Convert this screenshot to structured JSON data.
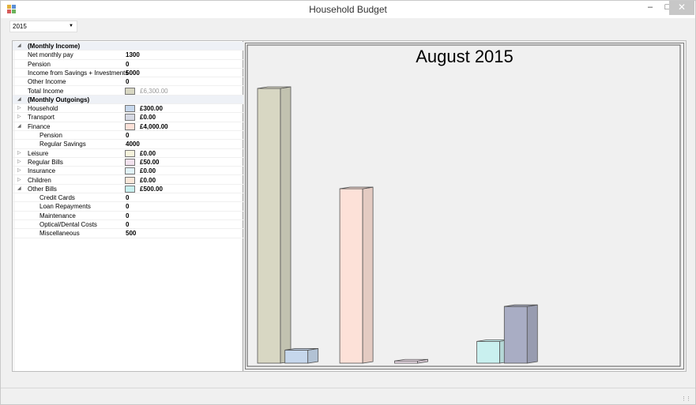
{
  "window": {
    "title": "Household Budget",
    "minimize": "–",
    "maximize": "□",
    "close": "✕"
  },
  "year_selector": {
    "value": "2015",
    "arrow": "▼"
  },
  "grid": {
    "rows": [
      {
        "kind": "cat",
        "toggle": "◢",
        "label": "(Monthly Income)",
        "value": ""
      },
      {
        "kind": "prop",
        "toggle": "",
        "label": "Net monthly pay",
        "value": "1300"
      },
      {
        "kind": "prop",
        "toggle": "",
        "label": "Pension",
        "value": "0"
      },
      {
        "kind": "prop",
        "toggle": "",
        "label": "Income from Savings + Investments",
        "value": "5000"
      },
      {
        "kind": "prop",
        "toggle": "",
        "label": "Other Income",
        "value": "0"
      },
      {
        "kind": "total",
        "toggle": "",
        "label": "Total Income",
        "value": "£6,300.00",
        "color": "#d8d7c3"
      },
      {
        "kind": "cat",
        "toggle": "◢",
        "label": "(Monthly Outgoings)",
        "value": ""
      },
      {
        "kind": "money",
        "toggle": "▷",
        "label": "Household",
        "value": "£300.00",
        "color": "#c6d7ec"
      },
      {
        "kind": "money",
        "toggle": "▷",
        "label": "Transport",
        "value": "£0.00",
        "color": "#d6d9e4"
      },
      {
        "kind": "money",
        "toggle": "◢",
        "label": "Finance",
        "value": "£4,000.00",
        "color": "#fde1d8"
      },
      {
        "kind": "sub",
        "toggle": "",
        "label": "Pension",
        "value": "0"
      },
      {
        "kind": "sub",
        "toggle": "",
        "label": "Regular Savings",
        "value": "4000"
      },
      {
        "kind": "money",
        "toggle": "▷",
        "label": "Leisure",
        "value": "£0.00",
        "color": "#f6f3dc"
      },
      {
        "kind": "money",
        "toggle": "▷",
        "label": "Regular Bills",
        "value": "£50.00",
        "color": "#f2e2ee"
      },
      {
        "kind": "money",
        "toggle": "▷",
        "label": "Insurance",
        "value": "£0.00",
        "color": "#e2f3f8"
      },
      {
        "kind": "money",
        "toggle": "▷",
        "label": "Children",
        "value": "£0.00",
        "color": "#fbe8da"
      },
      {
        "kind": "money",
        "toggle": "◢",
        "label": "Other Bills",
        "value": "£500.00",
        "color": "#c9f0ef"
      },
      {
        "kind": "sub",
        "toggle": "",
        "label": "Credit Cards",
        "value": "0"
      },
      {
        "kind": "sub",
        "toggle": "",
        "label": "Loan Repayments",
        "value": "0"
      },
      {
        "kind": "sub",
        "toggle": "",
        "label": "Maintenance",
        "value": "0"
      },
      {
        "kind": "sub",
        "toggle": "",
        "label": "Optical/Dental Costs",
        "value": "0"
      },
      {
        "kind": "sub",
        "toggle": "",
        "label": "Miscellaneous",
        "value": "500"
      }
    ]
  },
  "chart_data": {
    "type": "bar",
    "title": "August 2015",
    "xlabel": "",
    "ylabel": "",
    "ylim": [
      0,
      6300
    ],
    "grid": false,
    "legend": "none",
    "bars": [
      {
        "value": 6300,
        "color": "#d8d7c3",
        "slot": 0
      },
      {
        "value": 300,
        "color": "#c6d7ec",
        "slot": 1
      },
      {
        "value": 4000,
        "color": "#fde1d8",
        "slot": 3
      },
      {
        "value": 50,
        "color": "#f2e2ee",
        "slot": 5
      },
      {
        "value": 500,
        "color": "#c9f0ef",
        "slot": 8
      },
      {
        "value": 1300,
        "color": "#a9adc4",
        "slot": 9
      }
    ]
  }
}
